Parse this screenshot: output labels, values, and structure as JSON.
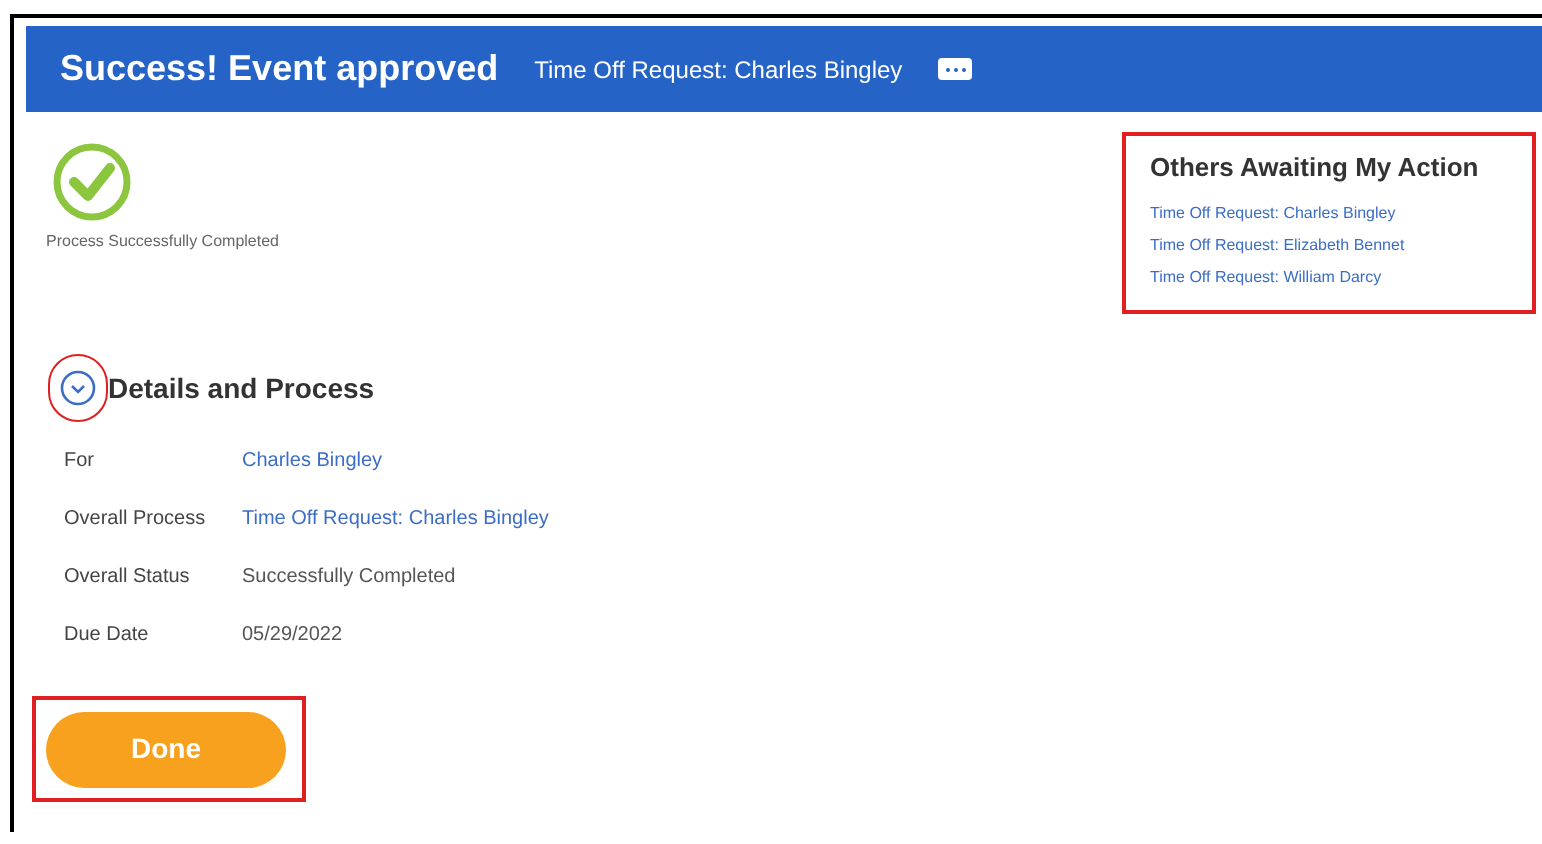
{
  "header": {
    "title": "Success! Event approved",
    "subtitle": "Time Off Request: Charles Bingley"
  },
  "status": {
    "message": "Process Successfully Completed"
  },
  "others": {
    "title": "Others Awaiting My Action",
    "links": [
      "Time Off Request: Charles Bingley",
      "Time Off Request: Elizabeth Bennet",
      "Time Off Request: William Darcy"
    ]
  },
  "details": {
    "title": "Details and Process",
    "expanded": true,
    "rows": [
      {
        "label": "For",
        "value": "Charles Bingley",
        "kind": "link"
      },
      {
        "label": "Overall Process",
        "value": "Time Off Request: Charles Bingley",
        "kind": "link"
      },
      {
        "label": "Overall Status",
        "value": "Successfully Completed",
        "kind": "text"
      },
      {
        "label": "Due Date",
        "value": "05/29/2022",
        "kind": "text"
      }
    ]
  },
  "done_button": {
    "label": "Done"
  }
}
